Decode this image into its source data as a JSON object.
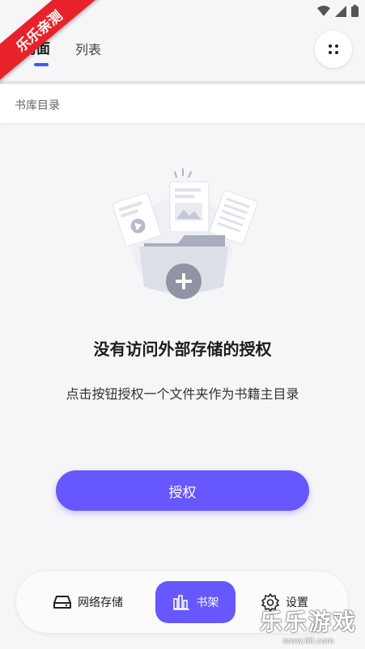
{
  "tabs": {
    "cover": "封面",
    "list": "列表"
  },
  "path_bar": {
    "text": "书库目录"
  },
  "empty_state": {
    "title": "没有访问外部存储的授权",
    "description": "点击按钮授权一个文件夹作为书籍主目录"
  },
  "primary_button": {
    "label": "授权"
  },
  "bottom_nav": {
    "items": [
      {
        "label": "网络存储",
        "icon": "drive-icon"
      },
      {
        "label": "书架",
        "icon": "bookshelf-icon",
        "active": true
      },
      {
        "label": "设置",
        "icon": "gear-icon"
      }
    ]
  },
  "colors": {
    "accent": "#6657ff",
    "tab_indicator": "#3b5bff",
    "ribbon": "#e8222a"
  },
  "overlay": {
    "ribbon_text": "乐乐亲测",
    "watermark": "乐乐游戏",
    "watermark_url": "www.6ll.com"
  }
}
